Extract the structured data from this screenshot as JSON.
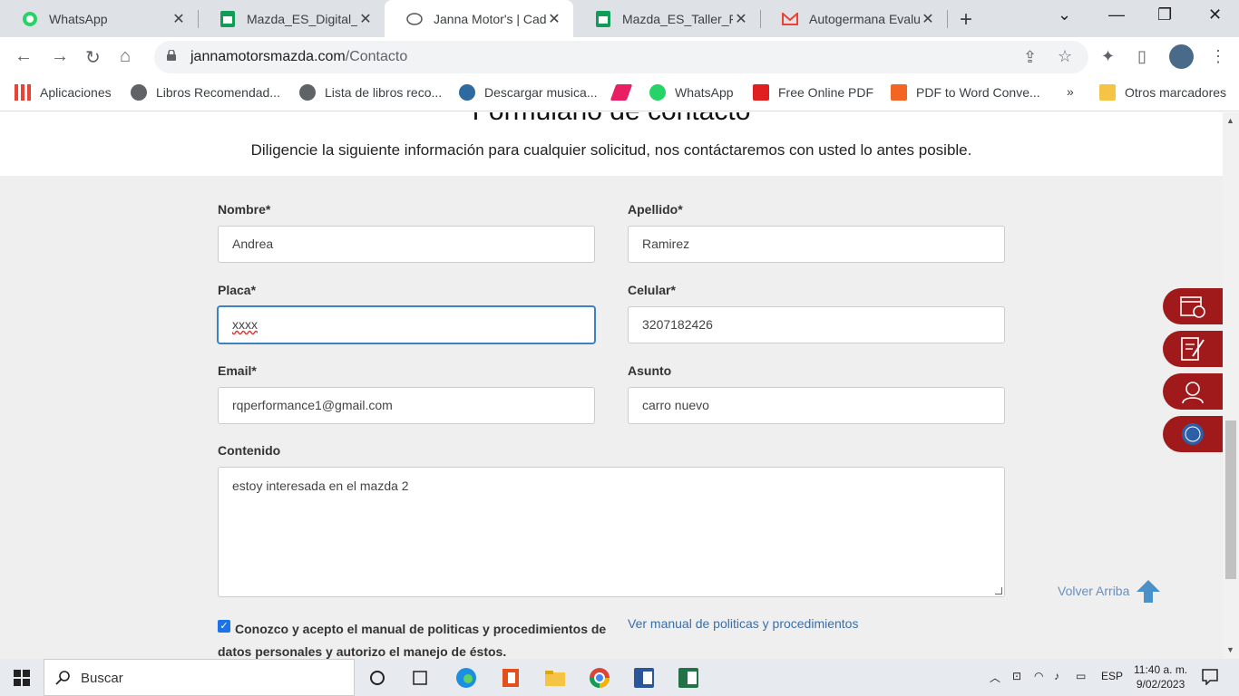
{
  "tabs": [
    {
      "title": "WhatsApp",
      "icon": "whatsapp-icon"
    },
    {
      "title": "Mazda_ES_Digital_Fe",
      "icon": "sheets-icon"
    },
    {
      "title": "Janna Motor's | Cada",
      "icon": "mazda-icon",
      "active": true
    },
    {
      "title": "Mazda_ES_Taller_Feb",
      "icon": "sheets-icon"
    },
    {
      "title": "Autogermana Evalua",
      "icon": "gmail-icon"
    }
  ],
  "address": {
    "domain": "jannamotorsmazda.com",
    "path": "/Contacto"
  },
  "bookmarks": [
    {
      "label": "Aplicaciones"
    },
    {
      "label": "Libros Recomendad..."
    },
    {
      "label": "Lista de libros reco..."
    },
    {
      "label": "Descargar musica..."
    },
    {
      "label": "WhatsApp"
    },
    {
      "label": "Free Online PDF"
    },
    {
      "label": "PDF to Word Conve..."
    },
    {
      "label": "Otros marcadores"
    }
  ],
  "page": {
    "title": "Formulario de contacto",
    "subtitle": "Diligencie la siguiente información para cualquier solicitud, nos contáctaremos con usted lo antes posible."
  },
  "form": {
    "nombre": {
      "label": "Nombre*",
      "value": "Andrea"
    },
    "apellido": {
      "label": "Apellido*",
      "value": "Ramirez"
    },
    "placa": {
      "label": "Placa*",
      "value": "xxxx"
    },
    "celular": {
      "label": "Celular*",
      "value": "3207182426"
    },
    "email": {
      "label": "Email*",
      "value": "rqperformance1@gmail.com"
    },
    "asunto": {
      "label": "Asunto",
      "value": "carro nuevo"
    },
    "contenido": {
      "label": "Contenido",
      "value": "estoy interesada en el mazda 2"
    },
    "consent": {
      "label": "Conozco y acepto el manual de politicas y procedimientos de datos personales y autorizo el manejo de éstos.",
      "checked": true
    },
    "policy_link": "Ver manual de politicas y procedimientos"
  },
  "back_to_top": "Volver Arriba",
  "side_buttons": [
    "calendar-icon",
    "form-icon",
    "support-agent-icon",
    "pse-icon"
  ],
  "taskbar": {
    "search": "Buscar",
    "lang": "ESP",
    "time": "11:40 a. m.",
    "date": "9/02/2023"
  },
  "colors": {
    "accent_red": "#a01a1c",
    "link_blue": "#3b6ea8",
    "focus_blue": "#3b82c4"
  }
}
